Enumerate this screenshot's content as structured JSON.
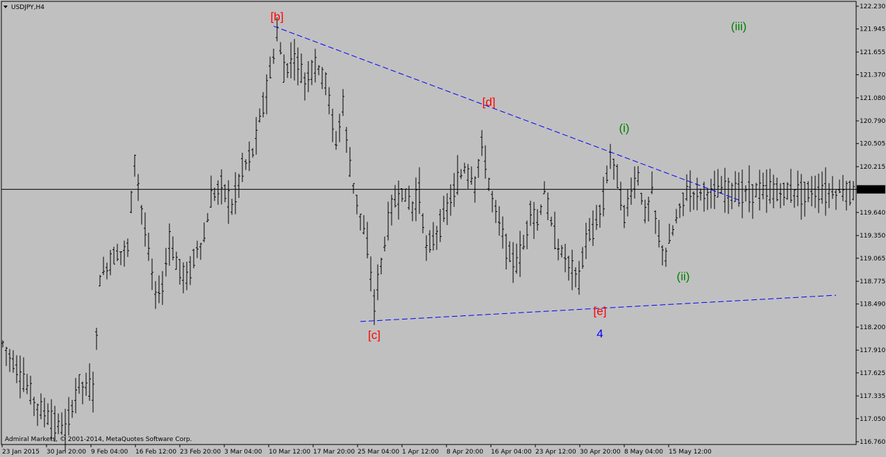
{
  "symbol": "USDJPY,H4",
  "copyright": "Admiral Markets, © 2001-2014, MetaQuotes Software Corp.",
  "colors": {
    "background": "#c0c0c0",
    "bars": "#000000",
    "trendline": "#0000ff",
    "wave_red": "#ff0000",
    "wave_green": "#008000",
    "wave_blue": "#0000ff",
    "current_price_label_bg": "#000000"
  },
  "chart_data": {
    "type": "ohlc",
    "title": "USDJPY,H4",
    "ylim": [
      116.76,
      122.23
    ],
    "y_ticks": [
      "122.230",
      "121.945",
      "121.655",
      "121.370",
      "121.080",
      "120.790",
      "120.505",
      "120.215",
      "119.930",
      "119.640",
      "119.350",
      "119.065",
      "118.775",
      "118.490",
      "118.200",
      "117.910",
      "117.625",
      "117.335",
      "117.050",
      "116.760"
    ],
    "x_ticks": [
      "23 Jan 2015",
      "30 Jan 20:00",
      "9 Feb 04:00",
      "16 Feb 12:00",
      "23 Feb 20:00",
      "3 Mar 04:00",
      "10 Mar 12:00",
      "17 Mar 20:00",
      "25 Mar 04:00",
      "1 Apr 12:00",
      "8 Apr 20:00",
      "16 Apr 04:00",
      "23 Apr 12:00",
      "30 Apr 20:00",
      "8 May 04:00",
      "15 May 12:00"
    ],
    "current_price": "119.930",
    "close_path": [
      [
        0,
        118.0
      ],
      [
        5,
        117.6
      ],
      [
        10,
        117.2
      ],
      [
        15,
        117.0
      ],
      [
        18,
        116.9
      ],
      [
        22,
        117.5
      ],
      [
        26,
        117.4
      ],
      [
        28,
        118.8
      ],
      [
        32,
        119.1
      ],
      [
        36,
        119.2
      ],
      [
        38,
        120.3
      ],
      [
        41,
        119.4
      ],
      [
        44,
        118.6
      ],
      [
        46,
        118.7
      ],
      [
        48,
        119.3
      ],
      [
        50,
        119.0
      ],
      [
        53,
        118.8
      ],
      [
        56,
        119.2
      ],
      [
        58,
        119.3
      ],
      [
        60,
        119.8
      ],
      [
        63,
        120.0
      ],
      [
        66,
        119.7
      ],
      [
        69,
        120.2
      ],
      [
        72,
        120.4
      ],
      [
        75,
        121.0
      ],
      [
        78,
        121.6
      ],
      [
        79,
        121.9
      ],
      [
        81,
        121.4
      ],
      [
        84,
        121.6
      ],
      [
        87,
        121.3
      ],
      [
        90,
        121.5
      ],
      [
        93,
        121.3
      ],
      [
        96,
        120.5
      ],
      [
        98,
        121.0
      ],
      [
        100,
        120.2
      ],
      [
        103,
        119.6
      ],
      [
        105,
        119.2
      ],
      [
        107,
        118.5
      ],
      [
        109,
        119.0
      ],
      [
        112,
        119.7
      ],
      [
        115,
        119.9
      ],
      [
        118,
        119.7
      ],
      [
        120,
        119.9
      ],
      [
        122,
        119.2
      ],
      [
        124,
        119.3
      ],
      [
        127,
        119.6
      ],
      [
        130,
        119.9
      ],
      [
        133,
        120.2
      ],
      [
        136,
        120.0
      ],
      [
        138,
        120.5
      ],
      [
        140,
        120.0
      ],
      [
        143,
        119.5
      ],
      [
        146,
        119.1
      ],
      [
        148,
        119.0
      ],
      [
        150,
        119.2
      ],
      [
        152,
        119.7
      ],
      [
        154,
        119.5
      ],
      [
        156,
        119.9
      ],
      [
        158,
        119.5
      ],
      [
        160,
        119.2
      ],
      [
        163,
        119.0
      ],
      [
        166,
        118.8
      ],
      [
        168,
        119.3
      ],
      [
        170,
        119.4
      ],
      [
        173,
        119.8
      ],
      [
        175,
        120.4
      ],
      [
        177,
        120.1
      ],
      [
        179,
        119.6
      ],
      [
        181,
        119.9
      ],
      [
        183,
        120.1
      ],
      [
        185,
        119.6
      ],
      [
        187,
        119.9
      ],
      [
        189,
        119.3
      ],
      [
        191,
        119.1
      ],
      [
        193,
        119.4
      ],
      [
        195,
        119.7
      ],
      [
        197,
        119.9
      ]
    ],
    "trendlines": [
      {
        "from": [
          78,
          121.98
        ],
        "to": [
          213,
          119.78
        ]
      },
      {
        "from": [
          103,
          118.27
        ],
        "to": [
          240,
          118.6
        ]
      }
    ],
    "horizontal_line": 119.93,
    "wave_labels": [
      {
        "text": "[b]",
        "x": 79,
        "price": 122.05,
        "color": "red"
      },
      {
        "text": "[d]",
        "x": 140,
        "price": 120.98,
        "color": "red"
      },
      {
        "text": "[c]",
        "x": 107,
        "price": 118.05,
        "color": "red"
      },
      {
        "text": "[e]",
        "x": 172,
        "price": 118.35,
        "color": "red"
      },
      {
        "text": "4",
        "x": 172,
        "price": 118.07,
        "color": "blue"
      },
      {
        "text": "(i)",
        "x": 179,
        "price": 120.65,
        "color": "green"
      },
      {
        "text": "(ii)",
        "x": 196,
        "price": 118.79,
        "color": "green"
      },
      {
        "text": "(iii)",
        "x": 212,
        "price": 121.93,
        "color": "green"
      }
    ],
    "bar_count": 248
  }
}
